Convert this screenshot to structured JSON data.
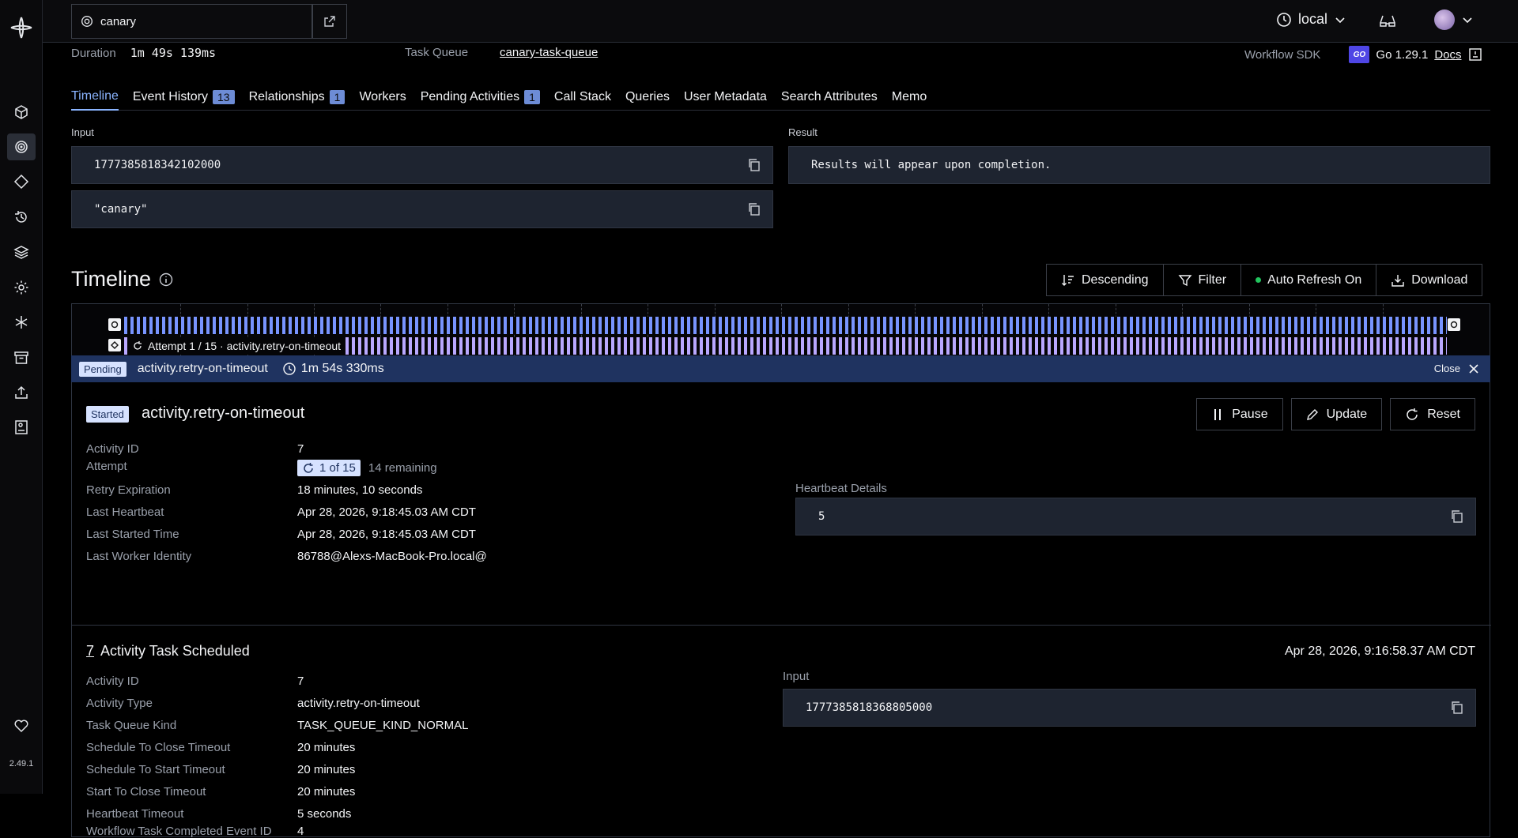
{
  "app": {
    "namespace": "canary",
    "environment": "local",
    "version": "2.49.1"
  },
  "summary": {
    "duration_label": "Duration",
    "duration_value": "1m 49s 139ms",
    "task_queue_label": "Task Queue",
    "task_queue_value": "canary-task-queue",
    "sdk_label": "Workflow SDK",
    "sdk_badge": "GO",
    "sdk_value": "Go 1.29.1",
    "docs_label": "Docs"
  },
  "tabs": [
    {
      "label": "Timeline",
      "count": ""
    },
    {
      "label": "Event History",
      "count": "13"
    },
    {
      "label": "Relationships",
      "count": "1"
    },
    {
      "label": "Workers",
      "count": ""
    },
    {
      "label": "Pending Activities",
      "count": "1"
    },
    {
      "label": "Call Stack",
      "count": ""
    },
    {
      "label": "Queries",
      "count": ""
    },
    {
      "label": "User Metadata",
      "count": ""
    },
    {
      "label": "Search Attributes",
      "count": ""
    },
    {
      "label": "Memo",
      "count": ""
    }
  ],
  "io": {
    "input_label": "Input",
    "input_values": [
      "1777385818342102000",
      "\"canary\""
    ],
    "result_label": "Result",
    "result_value": "Results will appear upon completion."
  },
  "timeline": {
    "title": "Timeline",
    "sort_label": "Descending",
    "filter_label": "Filter",
    "auto_refresh_label": "Auto Refresh On",
    "download_label": "Download",
    "attempt_label": "Attempt 1 / 15 · activity.retry-on-timeout"
  },
  "pending": {
    "badge": "Pending",
    "name": "activity.retry-on-timeout",
    "elapsed": "1m 54s 330ms",
    "close_label": "Close"
  },
  "activity": {
    "badge": "Started",
    "name": "activity.retry-on-timeout",
    "pause_label": "Pause",
    "update_label": "Update",
    "reset_label": "Reset",
    "fields": {
      "activity_id": {
        "k": "Activity ID",
        "v": "7"
      },
      "attempt": {
        "k": "Attempt",
        "v": "1 of 15",
        "remaining": "14 remaining"
      },
      "retry_expiration": {
        "k": "Retry Expiration",
        "v": "18 minutes, 10 seconds"
      },
      "last_heartbeat": {
        "k": "Last Heartbeat",
        "v": "Apr 28, 2026, 9:18:45.03 AM CDT"
      },
      "last_started": {
        "k": "Last Started Time",
        "v": "Apr 28, 2026, 9:18:45.03 AM CDT"
      },
      "last_worker": {
        "k": "Last Worker Identity",
        "v": "86788@Alexs-MacBook-Pro.local@"
      }
    },
    "heartbeat_label": "Heartbeat Details",
    "heartbeat_value": "5"
  },
  "event": {
    "number": "7",
    "title": "Activity Task Scheduled",
    "time": "Apr 28, 2026, 9:16:58.37 AM CDT",
    "input_label": "Input",
    "input_value": "1777385818368805000",
    "fields": [
      {
        "k": "Activity ID",
        "v": "7"
      },
      {
        "k": "Activity Type",
        "v": "activity.retry-on-timeout"
      },
      {
        "k": "Task Queue Kind",
        "v": "TASK_QUEUE_KIND_NORMAL"
      },
      {
        "k": "Schedule To Close Timeout",
        "v": "20 minutes"
      },
      {
        "k": "Schedule To Start Timeout",
        "v": "20 minutes"
      },
      {
        "k": "Start To Close Timeout",
        "v": "20 minutes"
      },
      {
        "k": "Heartbeat Timeout",
        "v": "5 seconds"
      },
      {
        "k": "Workflow Task Completed Event ID",
        "v": "4"
      }
    ]
  }
}
